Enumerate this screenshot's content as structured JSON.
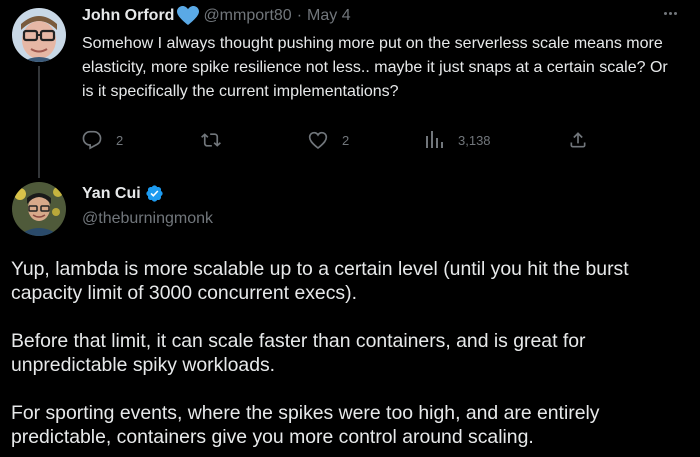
{
  "tweet1": {
    "author_name": "John Orford",
    "heart_emoji": "💙",
    "handle": "@mmport80",
    "separator": "·",
    "date": "May 4",
    "text": "Somehow I always thought pushing more put on the serverless scale means more elasticity, more spike resilience not less.. maybe it just snaps at a certain scale? Or is it specifically the current implementations?",
    "replies": "2",
    "retweets": "",
    "likes": "2",
    "views": "3,138"
  },
  "tweet2": {
    "author_name": "Yan Cui",
    "handle": "@theburningmonk",
    "paragraphs": [
      "Yup, lambda is more scalable up to a certain level (until you hit the burst capacity limit of 3000 concurrent execs).",
      "Before that limit, it can scale faster than containers, and is great for unpredictable spiky workloads.",
      "For sporting events, where the spikes were too high, and are entirely predictable, containers give you more control around scaling."
    ]
  },
  "colors": {
    "background": "#000000",
    "text_primary": "#e7e9ea",
    "text_muted": "#71767b",
    "verified_blue": "#1d9bf0",
    "thread_line": "#333639"
  },
  "icons": [
    "reply-icon",
    "retweet-icon",
    "like-icon",
    "views-icon",
    "share-icon",
    "verified-badge-icon",
    "more-icon"
  ]
}
